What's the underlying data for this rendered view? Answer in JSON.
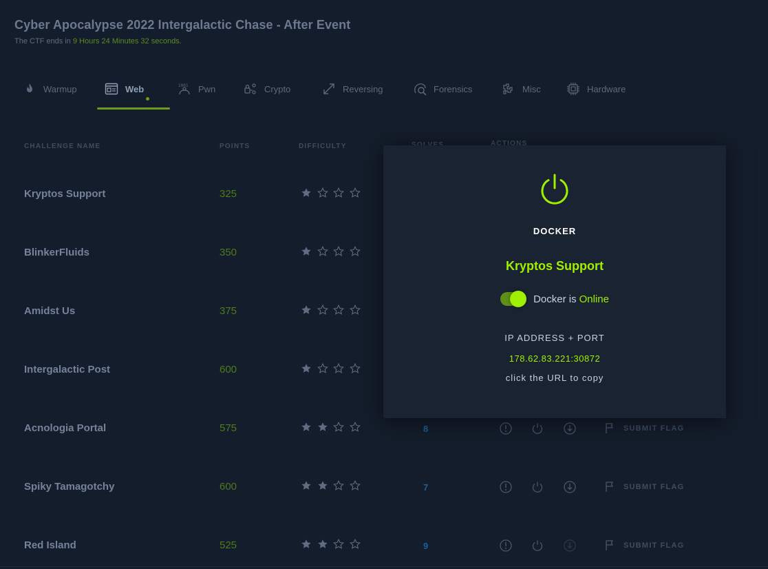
{
  "header": {
    "title": "Cyber Apocalypse 2022 Intergalactic Chase - After Event",
    "subtitle_prefix": "The CTF ends in",
    "subtitle_time": "9 Hours 24 Minutes 32 seconds."
  },
  "tabs": [
    {
      "label": "Warmup",
      "icon": "flame-icon"
    },
    {
      "label": "Web",
      "icon": "browser-icon",
      "active": true
    },
    {
      "label": "Pwn",
      "icon": "binary-icon"
    },
    {
      "label": "Crypto",
      "icon": "crypto-icon"
    },
    {
      "label": "Reversing",
      "icon": "reverse-arrow-icon"
    },
    {
      "label": "Forensics",
      "icon": "forensics-icon"
    },
    {
      "label": "Misc",
      "icon": "misc-icon"
    },
    {
      "label": "Hardware",
      "icon": "chip-icon"
    }
  ],
  "columns": {
    "name": "CHALLENGE NAME",
    "points": "POINTS",
    "difficulty": "DIFFICULTY",
    "solves": "SOLVES",
    "actions": "ACTIONS"
  },
  "rows": [
    {
      "name": "Kryptos Support",
      "points": "325",
      "difficulty": 1,
      "solves": ""
    },
    {
      "name": "BlinkerFluids",
      "points": "350",
      "difficulty": 1,
      "solves": ""
    },
    {
      "name": "Amidst Us",
      "points": "375",
      "difficulty": 1,
      "solves": ""
    },
    {
      "name": "Intergalactic Post",
      "points": "600",
      "difficulty": 1,
      "solves": ""
    },
    {
      "name": "Acnologia Portal",
      "points": "575",
      "difficulty": 2,
      "solves": "8"
    },
    {
      "name": "Spiky Tamagotchy",
      "points": "600",
      "difficulty": 2,
      "solves": "7"
    },
    {
      "name": "Red Island",
      "points": "525",
      "difficulty": 2,
      "solves": "9"
    }
  ],
  "submit_label": "SUBMIT FLAG",
  "modal": {
    "title": "DOCKER",
    "challenge": "Kryptos Support",
    "status_prefix": "Docker is",
    "status": "Online",
    "ip_label": "IP ADDRESS + PORT",
    "ip_value": "178.62.83.221:30872",
    "hint": "click the URL to copy"
  },
  "colors": {
    "background": "#141d2b",
    "accent": "#9fef00",
    "modal_bg": "#1a2332",
    "solves": "#1e5f97"
  }
}
